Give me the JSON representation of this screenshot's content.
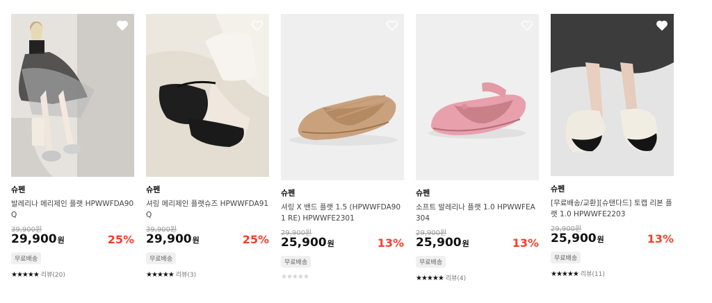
{
  "products": [
    {
      "brand": "슈펜",
      "title": "발레리나 메리제인 플랫 HPWWFDA90Q",
      "original_price": "39,900원",
      "price": "29,900",
      "currency": "원",
      "discount": "25%",
      "badge": "무료배송",
      "stars": "★★★★★",
      "review_label": "리뷰(20)"
    },
    {
      "brand": "슈펜",
      "title": "셔링 메리제인 플랫슈즈 HPWWFDA91Q",
      "original_price": "39,900원",
      "price": "29,900",
      "currency": "원",
      "discount": "25%",
      "badge": "무료배송",
      "stars": "★★★★★",
      "review_label": "리뷰(3)"
    },
    {
      "brand": "슈펜",
      "title": "셔링 X 밴드 플랫 1.5 (HPWWFDA901 RE) HPWWFE2301",
      "original_price": "29,900원",
      "price": "25,900",
      "currency": "원",
      "discount": "13%",
      "badge": "무료배송",
      "stars": "★★★★★",
      "review_label": ""
    },
    {
      "brand": "슈펜",
      "title": "소프트 발레리나 플랫 1.0 HPWWFEA304",
      "original_price": "29,900원",
      "price": "25,900",
      "currency": "원",
      "discount": "13%",
      "badge": "무료배송",
      "stars": "★★★★★",
      "review_label": "리뷰(4)"
    },
    {
      "brand": "슈펜",
      "title": "[무료배송/교환][슈탠다드] 토캡 리본 플랫 1.0 HPWWFE2203",
      "original_price": "29,900원",
      "price": "25,900",
      "currency": "원",
      "discount": "13%",
      "badge": "무료배송",
      "stars": "★★★★★",
      "review_label": "리뷰(11)"
    }
  ],
  "colors": {
    "discount": "#f43e2c",
    "text": "#222222",
    "muted": "#999999",
    "badge_bg": "#f0f0f0"
  },
  "icons": {
    "wishlist": "heart-outline-icon",
    "rating": "star-icon"
  }
}
